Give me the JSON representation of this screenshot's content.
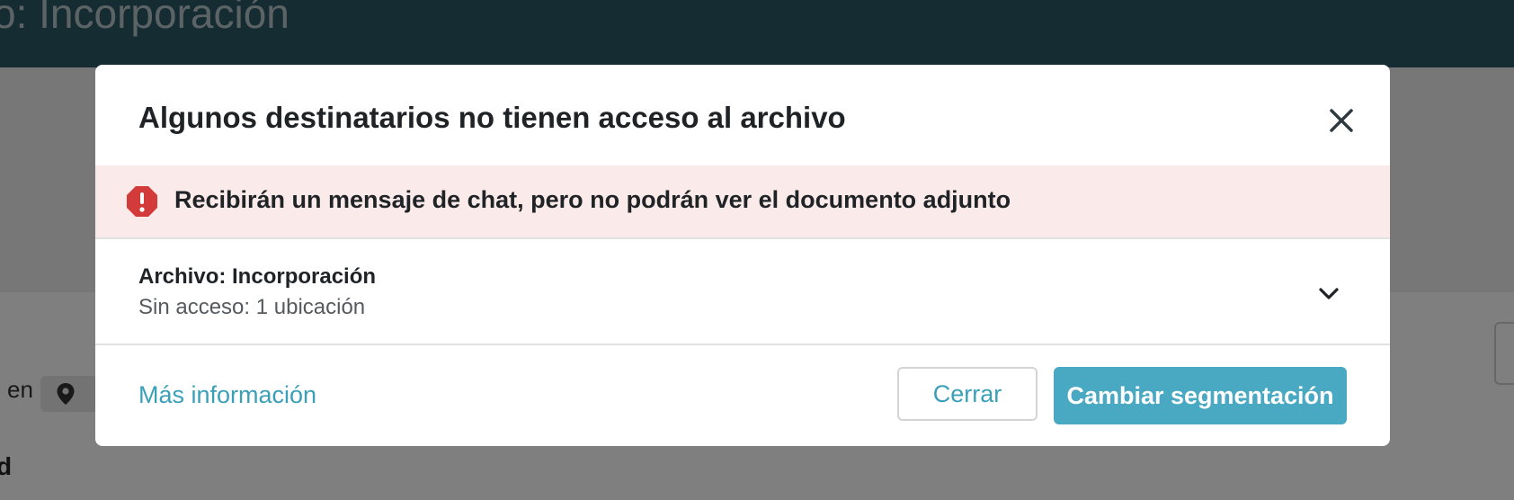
{
  "background": {
    "page_title": "o: Incorporación",
    "location_prefix": "en",
    "bottom_fragment": "d",
    "colors": {
      "header": "#2c5866"
    }
  },
  "modal": {
    "title": "Algunos destinatarios no tienen acceso al archivo",
    "close_icon": "close-icon",
    "alert": {
      "icon": "alert-octagon-icon",
      "text": "Recibirán un mensaje de chat, pero no podrán ver el documento adjunto",
      "colors": {
        "background": "#fbeaea",
        "icon": "#d33b3b"
      }
    },
    "file": {
      "name": "Archivo: Incorporación",
      "access": "Sin acceso: 1 ubicación",
      "expand_icon": "chevron-down-icon"
    },
    "footer": {
      "more_info_link": "Más información",
      "close_button": "Cerrar",
      "primary_button": "Cambiar segmentación",
      "colors": {
        "accent": "#4aa9c2",
        "link": "#3aa0b8"
      }
    }
  }
}
